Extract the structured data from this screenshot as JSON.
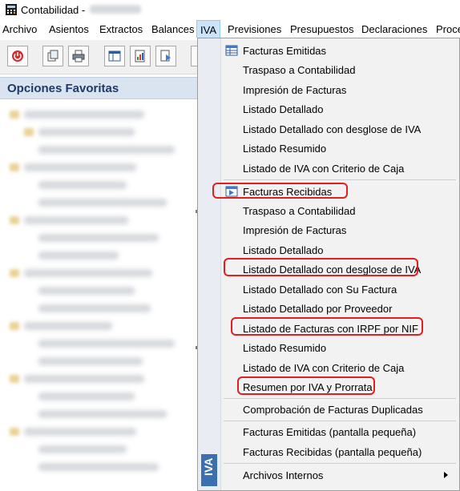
{
  "window": {
    "title": "Contabilidad -"
  },
  "menubar": {
    "items": [
      "Archivo",
      "Asientos",
      "Extractos",
      "Balances",
      "IVA",
      "Previsiones",
      "Presupuestos",
      "Declaraciones",
      "Proce"
    ],
    "active": "IVA"
  },
  "panel": {
    "title": "Opciones Favoritas"
  },
  "iva_menu": {
    "side_label": "IVA",
    "emitidas": [
      "Facturas Emitidas",
      "Traspaso a Contabilidad",
      "Impresión de Facturas",
      "Listado Detallado",
      "Listado Detallado con desglose de IVA",
      "Listado Resumido",
      "Listado de IVA con Criterio de Caja"
    ],
    "recibidas": [
      "Facturas Recibidas",
      "Traspaso a Contabilidad",
      "Impresión de Facturas",
      "Listado Detallado",
      "Listado Detallado con desglose de IVA",
      "Listado Detallado con Su Factura",
      "Listado Detallado por Proveedor",
      "Listado de Facturas con IRPF por NIF",
      "Listado Resumido",
      "Listado de IVA con Criterio de Caja",
      "Resumen por IVA y Prorrata"
    ],
    "comprobacion": "Comprobación de Facturas Duplicadas",
    "pequena": [
      "Facturas Emitidas (pantalla pequeña)",
      "Facturas Recibidas (pantalla pequeña)"
    ],
    "archivos": "Archivos Internos"
  },
  "colors": {
    "highlight": "#e02020",
    "panel_header": "#dae4f1",
    "side_label": "#3c6fb0"
  }
}
